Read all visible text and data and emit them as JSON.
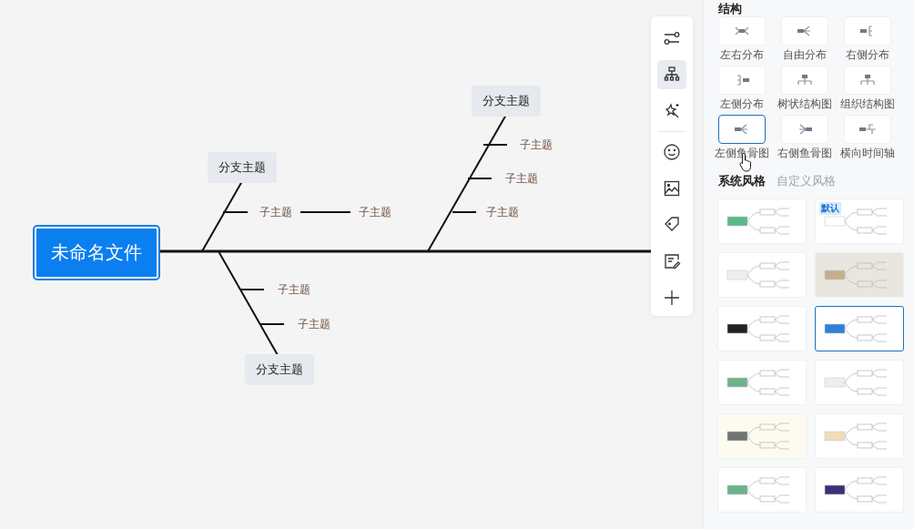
{
  "mindmap": {
    "root": "未命名文件",
    "branches": [
      {
        "label": "分支主题",
        "children": [
          {
            "label": "子主题",
            "children": [
              {
                "label": "子主题"
              }
            ]
          }
        ]
      },
      {
        "label": "分支主题",
        "children": [
          {
            "label": "子主题"
          },
          {
            "label": "子主题"
          }
        ]
      },
      {
        "label": "分支主题",
        "children": [
          {
            "label": "子主题"
          },
          {
            "label": "子主题"
          },
          {
            "label": "子主题"
          }
        ]
      }
    ]
  },
  "toolbar": [
    {
      "kind": "settings",
      "selected": false
    },
    {
      "kind": "structure",
      "selected": true
    },
    {
      "kind": "magic",
      "selected": false
    },
    {
      "kind": "emoji",
      "selected": false
    },
    {
      "kind": "image",
      "selected": false
    },
    {
      "kind": "tag",
      "selected": false
    },
    {
      "kind": "note",
      "selected": false
    },
    {
      "kind": "add",
      "selected": false
    }
  ],
  "structure": {
    "title": "结构",
    "items": [
      {
        "label": "左右分布",
        "selected": false
      },
      {
        "label": "自由分布",
        "selected": false
      },
      {
        "label": "右侧分布",
        "selected": false
      },
      {
        "label": "左侧分布",
        "selected": false
      },
      {
        "label": "树状结构图",
        "selected": false
      },
      {
        "label": "组织结构图",
        "selected": false
      },
      {
        "label": "左侧鱼骨图",
        "selected": true
      },
      {
        "label": "右侧鱼骨图",
        "selected": false
      },
      {
        "label": "横向时间轴",
        "selected": false
      }
    ]
  },
  "style_tabs": [
    {
      "label": "系统风格",
      "selected": true
    },
    {
      "label": "自定义风格",
      "selected": false
    }
  ],
  "styles": [
    {
      "color": "#5cb88a",
      "selected": false
    },
    {
      "color": "#ffffff",
      "selected": false,
      "badge": "默认"
    },
    {
      "color": "#eeeeee",
      "selected": false
    },
    {
      "color": "#c4ae8c",
      "selected": false
    },
    {
      "color": "#222222",
      "selected": false
    },
    {
      "color": "#2f7fd8",
      "selected": true
    },
    {
      "color": "#6db38a",
      "selected": false
    },
    {
      "color": "#eeeeee",
      "selected": false
    },
    {
      "color": "#707470",
      "selected": false
    },
    {
      "color": "#f1dcb8",
      "selected": false
    },
    {
      "color": "#6db38a",
      "selected": false
    },
    {
      "color": "#3c2f78",
      "selected": false
    }
  ]
}
